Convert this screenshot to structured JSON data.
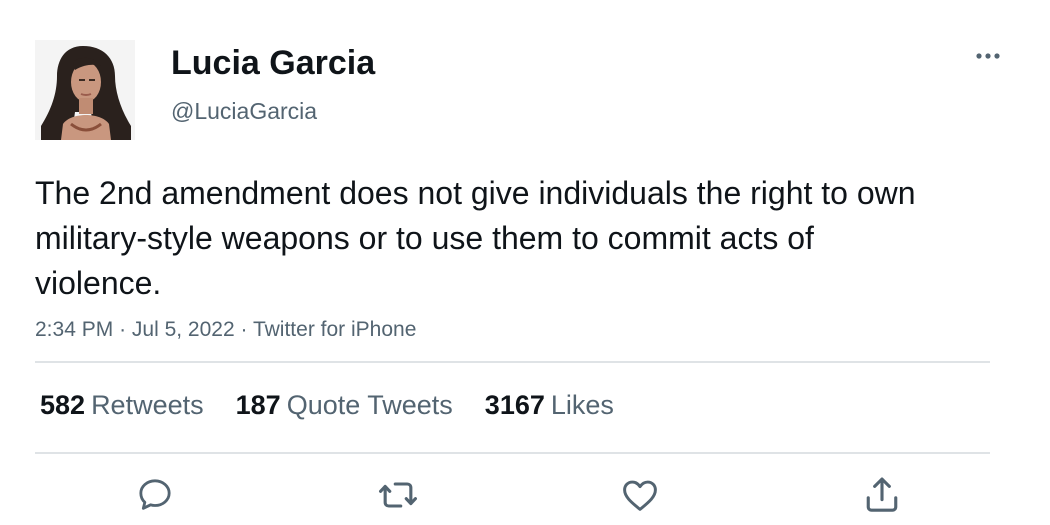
{
  "author": {
    "display_name": "Lucia Garcia",
    "handle": "@LuciaGarcia"
  },
  "tweet": {
    "text": "The 2nd amendment does not give individuals the right to own military-style weapons or to use them to commit acts of violence.",
    "time": "2:34 PM",
    "date": "Jul 5, 2022",
    "source": "Twitter for iPhone",
    "separator": "·"
  },
  "stats": {
    "retweets_count": "582",
    "retweets_label": "Retweets",
    "quotes_count": "187",
    "quotes_label": "Quote Tweets",
    "likes_count": "3167",
    "likes_label": "Likes"
  },
  "icons": {
    "more": "more-horizontal-icon",
    "reply": "reply-icon",
    "retweet": "retweet-icon",
    "like": "heart-icon",
    "share": "share-icon"
  },
  "colors": {
    "text_primary": "#0f1419",
    "text_secondary": "#536471",
    "divider": "#dfe3e6"
  }
}
